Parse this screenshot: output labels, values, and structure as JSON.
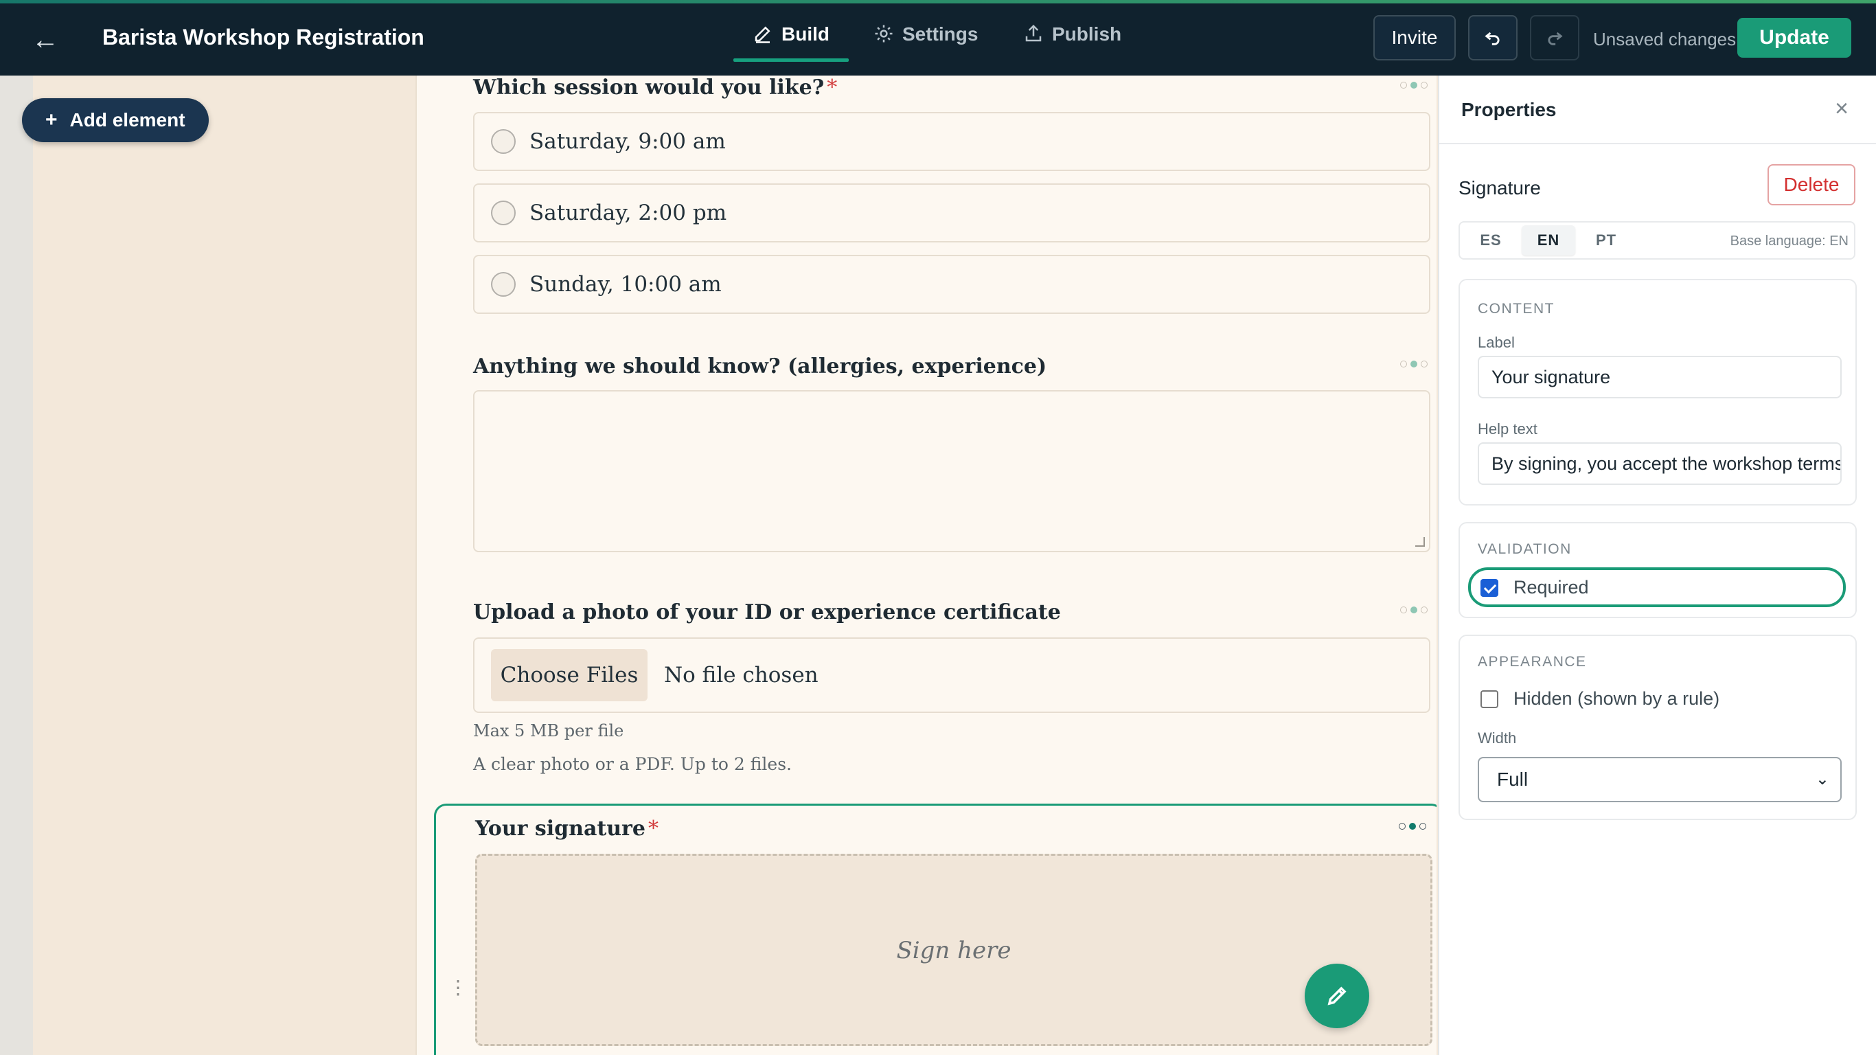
{
  "topbar": {
    "title": "Barista Workshop Registration",
    "tabs": [
      {
        "label": "Build",
        "icon": "pencil-icon",
        "active": true
      },
      {
        "label": "Settings",
        "icon": "gear-icon",
        "active": false
      },
      {
        "label": "Publish",
        "icon": "upload-icon",
        "active": false
      }
    ],
    "invite_label": "Invite",
    "status": "Unsaved changes",
    "update_label": "Update"
  },
  "sidebar": {
    "add_element_label": "Add element"
  },
  "form": {
    "session_question": "Which session would you like?",
    "session_required": "*",
    "session_options": [
      "Saturday, 9:00 am",
      "Saturday, 2:00 pm",
      "Sunday, 10:00 am"
    ],
    "notes_question": "Anything we should know? (allergies, experience)",
    "upload_question": "Upload a photo of your ID or experience certificate",
    "choose_files_label": "Choose Files",
    "no_file_text": "No file chosen",
    "upload_limit": "Max 5 MB per file",
    "upload_help": "A clear photo or a PDF. Up to 2 files.",
    "signature_question": "Your signature",
    "signature_required": "*",
    "signature_placeholder": "Sign here"
  },
  "properties": {
    "title": "Properties",
    "element_type": "Signature",
    "delete_label": "Delete",
    "languages": [
      {
        "code": "ES",
        "active": false
      },
      {
        "code": "EN",
        "active": true
      },
      {
        "code": "PT",
        "active": false
      }
    ],
    "base_language": "Base language: EN",
    "content": {
      "heading": "CONTENT",
      "label_title": "Label",
      "label_value": "Your signature",
      "help_title": "Help text",
      "help_value": "By signing, you accept the workshop terms."
    },
    "validation": {
      "heading": "VALIDATION",
      "required_label": "Required",
      "required_checked": true
    },
    "appearance": {
      "heading": "APPEARANCE",
      "hidden_label": "Hidden (shown by a rule)",
      "hidden_checked": false,
      "width_title": "Width",
      "width_value": "Full"
    }
  },
  "colors": {
    "accent": "#1a9b77",
    "topbar": "#10222e",
    "required": "#d23b3b"
  }
}
